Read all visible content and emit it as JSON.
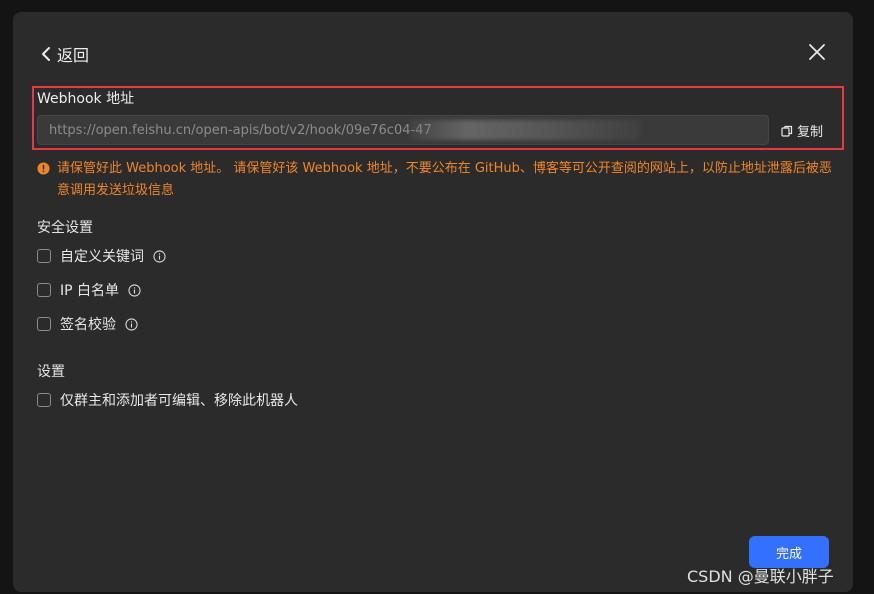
{
  "header": {
    "back_label": "返回"
  },
  "webhook": {
    "title": "Webhook 地址",
    "url": "https://open.feishu.cn/open-apis/bot/v2/hook/09e76c04-47",
    "copy_label": "复制",
    "warning": "请保管好此 Webhook 地址。 请保管好该 Webhook 地址，不要公布在 GitHub、博客等可公开查阅的网站上，以防止地址泄露后被恶意调用发送垃圾信息"
  },
  "security": {
    "title": "安全设置",
    "options": [
      {
        "label": "自定义关键词",
        "checked": false
      },
      {
        "label": "IP 白名单",
        "checked": false
      },
      {
        "label": "签名校验",
        "checked": false
      }
    ]
  },
  "settings": {
    "title": "设置",
    "options": [
      {
        "label": "仅群主和添加者可编辑、移除此机器人",
        "checked": false
      }
    ]
  },
  "footer": {
    "done_label": "完成"
  },
  "watermark": "CSDN @曼联小胖子",
  "colors": {
    "accent": "#3370ff",
    "warning": "#f0862a",
    "highlight_border": "#e8393e",
    "dialog_bg": "#2b2b2b"
  },
  "icons": {
    "back": "chevron-left-icon",
    "close": "close-icon",
    "copy": "copy-icon",
    "warning": "warning-icon",
    "info": "info-icon"
  }
}
